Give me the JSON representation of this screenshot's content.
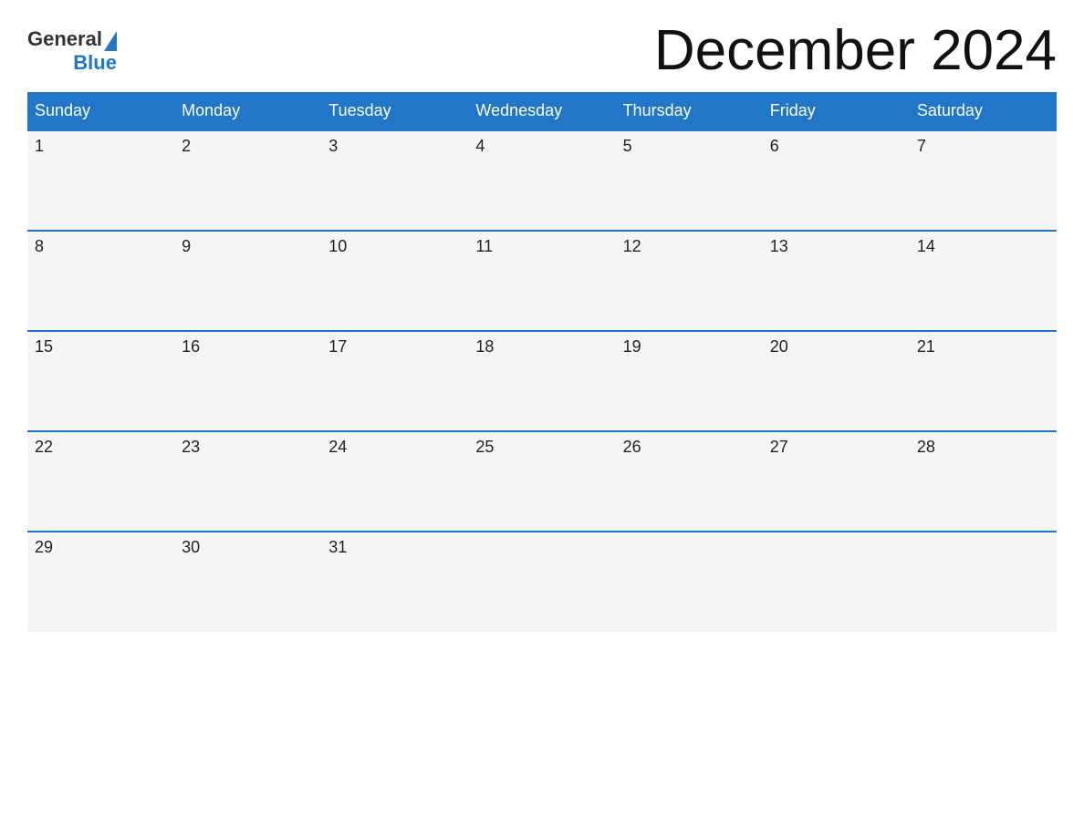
{
  "header": {
    "logo": {
      "general_text": "General",
      "blue_text": "Blue"
    },
    "title": "December 2024"
  },
  "calendar": {
    "days_of_week": [
      "Sunday",
      "Monday",
      "Tuesday",
      "Wednesday",
      "Thursday",
      "Friday",
      "Saturday"
    ],
    "weeks": [
      [
        {
          "date": "1",
          "empty": false
        },
        {
          "date": "2",
          "empty": false
        },
        {
          "date": "3",
          "empty": false
        },
        {
          "date": "4",
          "empty": false
        },
        {
          "date": "5",
          "empty": false
        },
        {
          "date": "6",
          "empty": false
        },
        {
          "date": "7",
          "empty": false
        }
      ],
      [
        {
          "date": "8",
          "empty": false
        },
        {
          "date": "9",
          "empty": false
        },
        {
          "date": "10",
          "empty": false
        },
        {
          "date": "11",
          "empty": false
        },
        {
          "date": "12",
          "empty": false
        },
        {
          "date": "13",
          "empty": false
        },
        {
          "date": "14",
          "empty": false
        }
      ],
      [
        {
          "date": "15",
          "empty": false
        },
        {
          "date": "16",
          "empty": false
        },
        {
          "date": "17",
          "empty": false
        },
        {
          "date": "18",
          "empty": false
        },
        {
          "date": "19",
          "empty": false
        },
        {
          "date": "20",
          "empty": false
        },
        {
          "date": "21",
          "empty": false
        }
      ],
      [
        {
          "date": "22",
          "empty": false
        },
        {
          "date": "23",
          "empty": false
        },
        {
          "date": "24",
          "empty": false
        },
        {
          "date": "25",
          "empty": false
        },
        {
          "date": "26",
          "empty": false
        },
        {
          "date": "27",
          "empty": false
        },
        {
          "date": "28",
          "empty": false
        }
      ],
      [
        {
          "date": "29",
          "empty": false
        },
        {
          "date": "30",
          "empty": false
        },
        {
          "date": "31",
          "empty": false
        },
        {
          "date": "",
          "empty": true
        },
        {
          "date": "",
          "empty": true
        },
        {
          "date": "",
          "empty": true
        },
        {
          "date": "",
          "empty": true
        }
      ]
    ]
  }
}
